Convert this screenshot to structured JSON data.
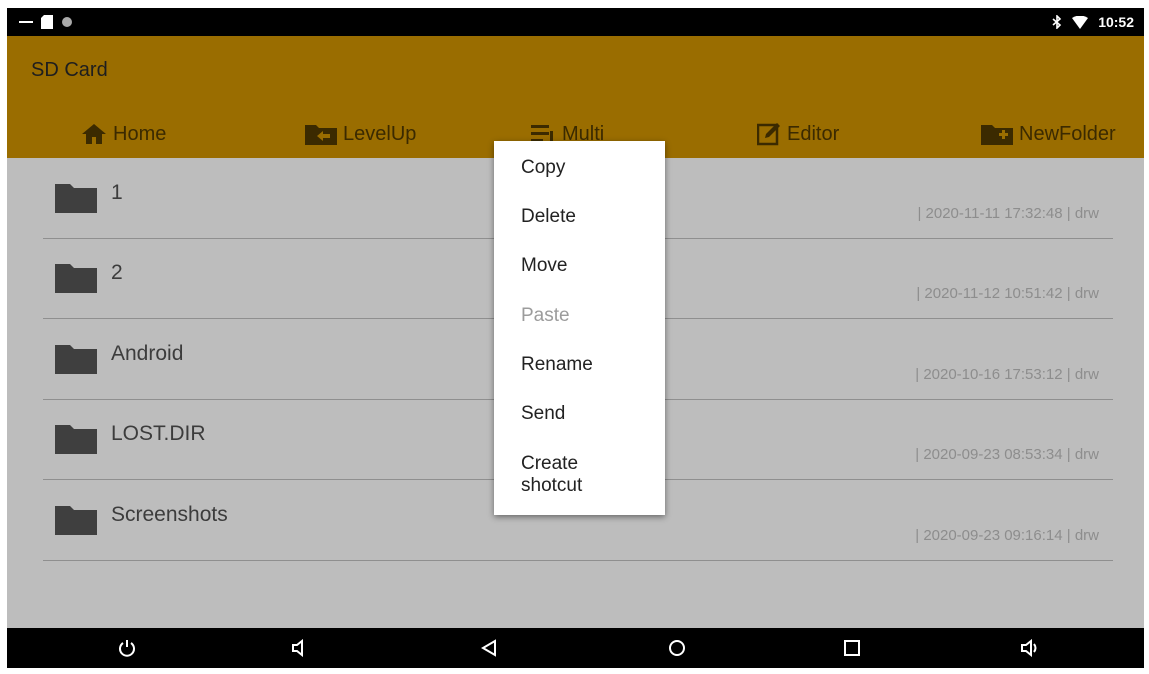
{
  "status_bar": {
    "time": "10:52",
    "icons": [
      "minus-icon",
      "sd-card-icon",
      "dot-icon",
      "bluetooth-icon",
      "wifi-icon"
    ]
  },
  "app_bar": {
    "title": "SD Card",
    "toolbar": [
      {
        "label": "Home",
        "icon": "home-icon"
      },
      {
        "label": "LevelUp",
        "icon": "folder-up-icon"
      },
      {
        "label": "Multi",
        "icon": "multi-select-icon"
      },
      {
        "label": "Editor",
        "icon": "edit-icon"
      },
      {
        "label": "NewFolder",
        "icon": "folder-add-icon"
      }
    ]
  },
  "files": [
    {
      "name": "1",
      "meta": "| 2020-11-11 17:32:48 | drw"
    },
    {
      "name": "2",
      "meta": "| 2020-11-12 10:51:42 | drw"
    },
    {
      "name": "Android",
      "meta": "| 2020-10-16 17:53:12 | drw"
    },
    {
      "name": "LOST.DIR",
      "meta": "| 2020-09-23 08:53:34 | drw"
    },
    {
      "name": "Screenshots",
      "meta": "| 2020-09-23 09:16:14 | drw"
    }
  ],
  "context_menu": {
    "items": [
      {
        "label": "Copy",
        "enabled": true
      },
      {
        "label": "Delete",
        "enabled": true
      },
      {
        "label": "Move",
        "enabled": true
      },
      {
        "label": "Paste",
        "enabled": false
      },
      {
        "label": "Rename",
        "enabled": true
      },
      {
        "label": "Send",
        "enabled": true
      },
      {
        "label": "Create",
        "label_line2": "shotcut",
        "enabled": true
      }
    ]
  },
  "nav_bar": {
    "buttons": [
      "power-icon",
      "volume-down-icon",
      "back-icon",
      "home-circle-icon",
      "recents-icon",
      "volume-up-icon"
    ]
  },
  "colors": {
    "app_bar": "#9a6d00",
    "list_background": "#bdbdbd",
    "menu_background": "#ffffff",
    "disabled_text": "#9c9c9c"
  }
}
